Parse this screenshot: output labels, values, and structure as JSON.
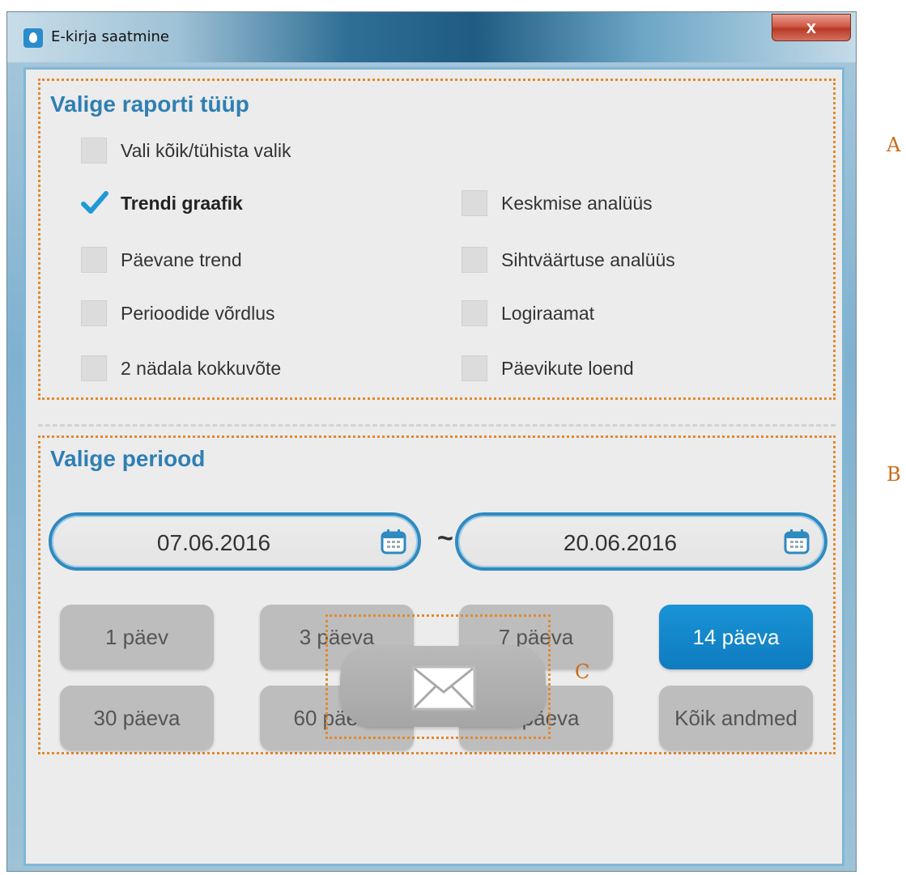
{
  "window": {
    "title": "E-kirja saatmine",
    "close_label": "x"
  },
  "report_section": {
    "title": "Valige raporti tüüp",
    "select_all": {
      "label": "Vali kõik/tühista valik",
      "checked": false
    },
    "left_options": [
      {
        "label": "Trendi graafik",
        "checked": true
      },
      {
        "label": "Päevane trend",
        "checked": false
      },
      {
        "label": "Perioodide võrdlus",
        "checked": false
      },
      {
        "label": "2 nädala kokkuvõte",
        "checked": false
      }
    ],
    "right_options": [
      {
        "label": "Keskmise analüüs",
        "checked": false
      },
      {
        "label": "Sihtväärtuse analüüs",
        "checked": false
      },
      {
        "label": "Logiraamat",
        "checked": false
      },
      {
        "label": "Päevikute loend",
        "checked": false
      }
    ]
  },
  "period_section": {
    "title": "Valige periood",
    "start_date": "07.06.2016",
    "separator": "~",
    "end_date": "20.06.2016",
    "buttons": [
      {
        "label": "1 päev",
        "active": false
      },
      {
        "label": "3 päeva",
        "active": false
      },
      {
        "label": "7 päeva",
        "active": false
      },
      {
        "label": "14 päeva",
        "active": true
      },
      {
        "label": "30 päeva",
        "active": false
      },
      {
        "label": "60 päeva",
        "active": false
      },
      {
        "label": "90 päeva",
        "active": false
      },
      {
        "label": "Kõik andmed",
        "active": false
      }
    ]
  },
  "send_button": {
    "icon": "envelope-icon"
  },
  "annotations": {
    "a": "A",
    "b": "B",
    "c": "C"
  },
  "colors": {
    "accent": "#2f7fb3",
    "active_button": "#1894d6",
    "annotation": "#e2892e"
  }
}
